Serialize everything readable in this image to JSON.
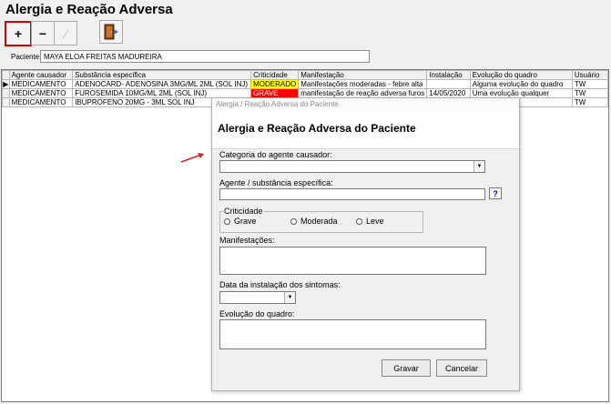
{
  "window": {
    "title": "Alergia e Reação Adversa"
  },
  "toolbar": {
    "add_label": "+",
    "remove_label": "−",
    "edit_label": "⁄",
    "exit_icon": "door-exit-icon"
  },
  "patient": {
    "label": "Paciente:",
    "value": "MAYA ELOA FREITAS MADUREIRA"
  },
  "table": {
    "headers": [
      "Agente causador",
      "Substância específica",
      "Criticidade",
      "Manifestação",
      "Instalação",
      "Evolução do quadro",
      "Usuário"
    ],
    "rows": [
      {
        "agent": "MEDICAMENTO",
        "substance": "ADENOCARD- ADENOSINA 3MG/ML 2ML (SOL INJ)",
        "criticality": "MODERADO",
        "manifestation": "Manifestações moderadas - febre alta",
        "installation": "",
        "evolution": "Alguma evolução do quadro",
        "user": "TW"
      },
      {
        "agent": "MEDICAMENTO",
        "substance": "FUROSEMIDA 10MG/ML 2ML (SOL INJ)",
        "criticality": "GRAVE",
        "manifestation": "manifestação de reação adversa furos",
        "installation": "14/05/2020",
        "evolution": "Uma evolução qualquer",
        "user": "TW"
      },
      {
        "agent": "MEDICAMENTO",
        "substance": "IBUPROFENO 20MG - 3ML SOL INJ",
        "criticality": "",
        "manifestation": "",
        "installation": "",
        "evolution": "",
        "user": "TW"
      }
    ],
    "criticality_colors": {
      "MODERADO": "#ffff00",
      "GRAVE": "#ff0000"
    }
  },
  "dialog": {
    "window_title": "Alergia / Reação Adversa do Paciente",
    "heading": "Alergia e Reação Adversa do Paciente",
    "category_label": "Categoria do agente causador:",
    "category_value": "",
    "substance_label": "Agente / substância específica:",
    "substance_value": "",
    "help_label": "?",
    "criticality_legend": "Criticidade",
    "criticality_options": [
      "Grave",
      "Moderada",
      "Leve"
    ],
    "manifestations_label": "Manifestações:",
    "manifestations_value": "",
    "date_label": "Data da instalação dos sintomas:",
    "date_value": "",
    "evolution_label": "Evolução do quadro:",
    "evolution_value": "",
    "save_label": "Gravar",
    "cancel_label": "Cancelar"
  },
  "colors": {
    "annotation_arrow": "#e02020",
    "highlight_border": "#d60000"
  }
}
